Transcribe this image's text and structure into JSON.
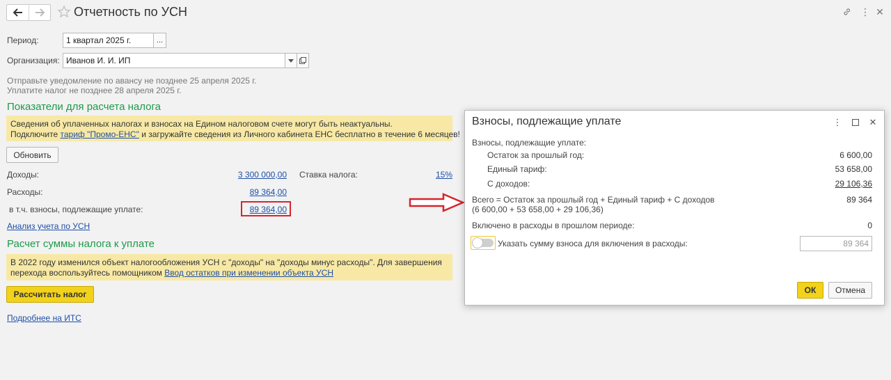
{
  "window": {
    "title": "Отчетность по УСН"
  },
  "form": {
    "period_label": "Период:",
    "period_value": "1 квартал 2025 г.",
    "period_select": "...",
    "org_label": "Организация:",
    "org_value": "Иванов И. И. ИП",
    "notice_line1": "Отправьте уведомление по авансу не позднее 25 апреля 2025 г.",
    "notice_line2": "Уплатите налог не позднее 28 апреля 2025 г."
  },
  "indicators": {
    "title": "Показатели для расчета налога",
    "info_line1": "Сведения об уплаченных налогах и взносах на Едином налоговом счете могут быть неактуальны.",
    "info_line2_prefix": "Подключите ",
    "info_line2_link": "тариф \"Промо-ЕНС\"",
    "info_line2_suffix": " и загружайте сведения из Личного кабинета ЕНС бесплатно в течение 6 месяцев!",
    "refresh_button": "Обновить",
    "income_label": "Доходы:",
    "income_value": "3 300 000,00",
    "rate_label": "Ставка налога:",
    "rate_value": "15%",
    "expenses_label": "Расходы:",
    "expenses_value": "89 364,00",
    "contrib_label": "в т.ч. взносы, подлежащие уплате:",
    "contrib_value": "89 364,00",
    "analysis_link": "Анализ учета по УСН"
  },
  "calculation": {
    "title": "Расчет суммы налога к уплате",
    "info_line1": "В 2022 году изменился объект налогообложения УСН с \"доходы\" на \"доходы минус расходы\". Для завершения",
    "info_line2_prefix": "перехода воспользуйтесь помощником ",
    "info_line2_link": "Ввод остатков при изменении объекта УСН",
    "calc_button": "Рассчитать налог",
    "its_link": "Подробнее на ИТС"
  },
  "modal": {
    "title": "Взносы, подлежащие уплате",
    "heading": "Взносы, подлежащие уплате:",
    "rows": [
      {
        "label": "Остаток за прошлый год:",
        "value": "6 600,00"
      },
      {
        "label": "Единый тариф:",
        "value": "53 658,00"
      },
      {
        "label": "С доходов:",
        "value": "29 106,36"
      }
    ],
    "total_line1": "Всего = Остаток за прошлый год + Единый тариф + С доходов",
    "total_line2": "(6 600,00 + 53 658,00 + 29 106,36)",
    "total_value": "89 364",
    "included_label": "Включено в расходы в прошлом периоде:",
    "included_value": "0",
    "toggle_label": "Указать сумму взноса для включения в расходы:",
    "toggle_state": "off",
    "amount_field": "89 364",
    "ok_button": "ОК",
    "cancel_button": "Отмена"
  },
  "colors": {
    "section_title": "#1d9a4a",
    "info_box": "#f7e9a5",
    "highlight_frame": "#d9232e",
    "primary_button": "#f2d21a",
    "link": "#1f4fa8"
  }
}
